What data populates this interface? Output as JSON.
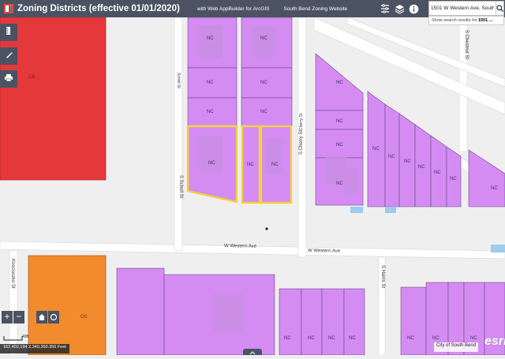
{
  "header": {
    "title": "Zoning Districts (effective 01/01/2020)",
    "subtitle": "with Web AppBuilder for ArcGIS",
    "link": "South Bend Zoning Website",
    "logo_icon": "map-logo-icon",
    "icons": [
      "filter-icon",
      "layers-icon",
      "info-icon"
    ]
  },
  "search": {
    "value": "1501 W Western Ave, South",
    "suggestion_prefix": "Show search results for ",
    "suggestion_term": "1501 ..."
  },
  "toolbox": {
    "icons": [
      "ruler-icon",
      "pencil-icon",
      "print-icon"
    ]
  },
  "zoom": {
    "in_label": "+",
    "out_label": "−"
  },
  "scale": {
    "label": "40ft"
  },
  "coordinates": "162,402,194 2,340,350.356 Feet",
  "attribution": "City of South Bend",
  "esri_logo": "esri",
  "map": {
    "colors": {
      "background": "#efefef",
      "road": "#ffffff",
      "parcel_line": "#c9c9c9",
      "nc_fill": "#d48cf3",
      "nc_border": "#6d4a87",
      "building": "#c98fe4",
      "red_zone": "#e5383b",
      "orange_zone": "#f28a2e",
      "highlight": "#f4d23b",
      "water": "#9ecbf0"
    },
    "street_labels": [
      {
        "text": "W Western Ave",
        "id": "western-1"
      },
      {
        "text": "W Western Ave",
        "id": "western-2"
      },
      {
        "text": "S Scholl St",
        "id": "scholl"
      },
      {
        "text": "S Cherry St",
        "id": "cherry"
      },
      {
        "text": "S Harris St",
        "id": "harris"
      },
      {
        "text": "S Chestnut St",
        "id": "chestnut"
      },
      {
        "text": "Kosciuszko St",
        "id": "kosciuszko"
      },
      {
        "text": "Cherry St",
        "id": "cherry-n"
      },
      {
        "text": "Scholl St",
        "id": "scholl-n"
      }
    ],
    "zone_labels": {
      "nc": "NC",
      "red": "CB",
      "orange": "OS"
    }
  }
}
